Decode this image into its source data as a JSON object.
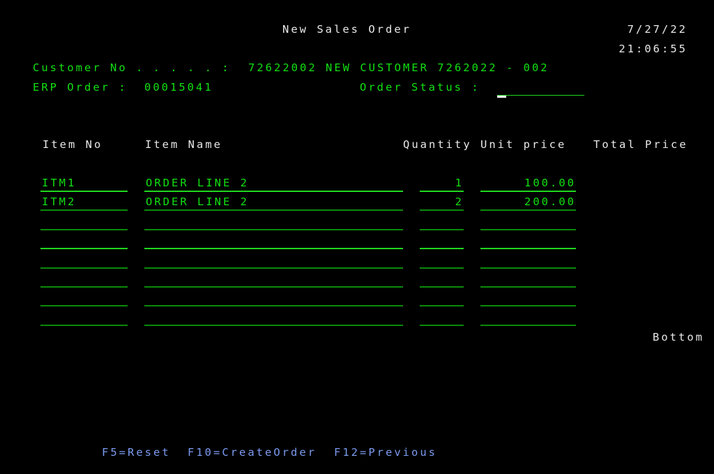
{
  "header": {
    "title": "New Sales Order",
    "date": "7/27/22",
    "time": "21:06:55"
  },
  "customer": {
    "label": "Customer No . . . . . :",
    "value": "72622002 NEW CUSTOMER 7262022 - 002"
  },
  "erp_order": {
    "label": "ERP Order :",
    "value": "00015041"
  },
  "order_status": {
    "label": "Order Status :",
    "value": ""
  },
  "table": {
    "columns": [
      "Item No",
      "Item Name",
      "Quantity",
      "Unit price",
      "Total Price"
    ],
    "rows": [
      {
        "item_no": "ITM1",
        "item_name": "ORDER LINE 2",
        "quantity": "1",
        "unit_price": "100.00",
        "total_price": ""
      },
      {
        "item_no": "ITM2",
        "item_name": "ORDER LINE 2",
        "quantity": "2",
        "unit_price": "200.00",
        "total_price": ""
      },
      {
        "item_no": "",
        "item_name": "",
        "quantity": "",
        "unit_price": "",
        "total_price": ""
      },
      {
        "item_no": "",
        "item_name": "",
        "quantity": "",
        "unit_price": "",
        "total_price": ""
      },
      {
        "item_no": "",
        "item_name": "",
        "quantity": "",
        "unit_price": "",
        "total_price": ""
      },
      {
        "item_no": "",
        "item_name": "",
        "quantity": "",
        "unit_price": "",
        "total_price": ""
      },
      {
        "item_no": "",
        "item_name": "",
        "quantity": "",
        "unit_price": "",
        "total_price": ""
      },
      {
        "item_no": "",
        "item_name": "",
        "quantity": "",
        "unit_price": "",
        "total_price": ""
      }
    ],
    "scroll_indicator": "Bottom"
  },
  "function_keys": [
    {
      "label": "F5=Reset"
    },
    {
      "label": "F10=CreateOrder"
    },
    {
      "label": "F12=Previous"
    }
  ],
  "colors": {
    "background": "#000000",
    "label_white": "#e8e8e8",
    "field_green": "#12e012",
    "function_key_blue": "#7b9bf0"
  }
}
